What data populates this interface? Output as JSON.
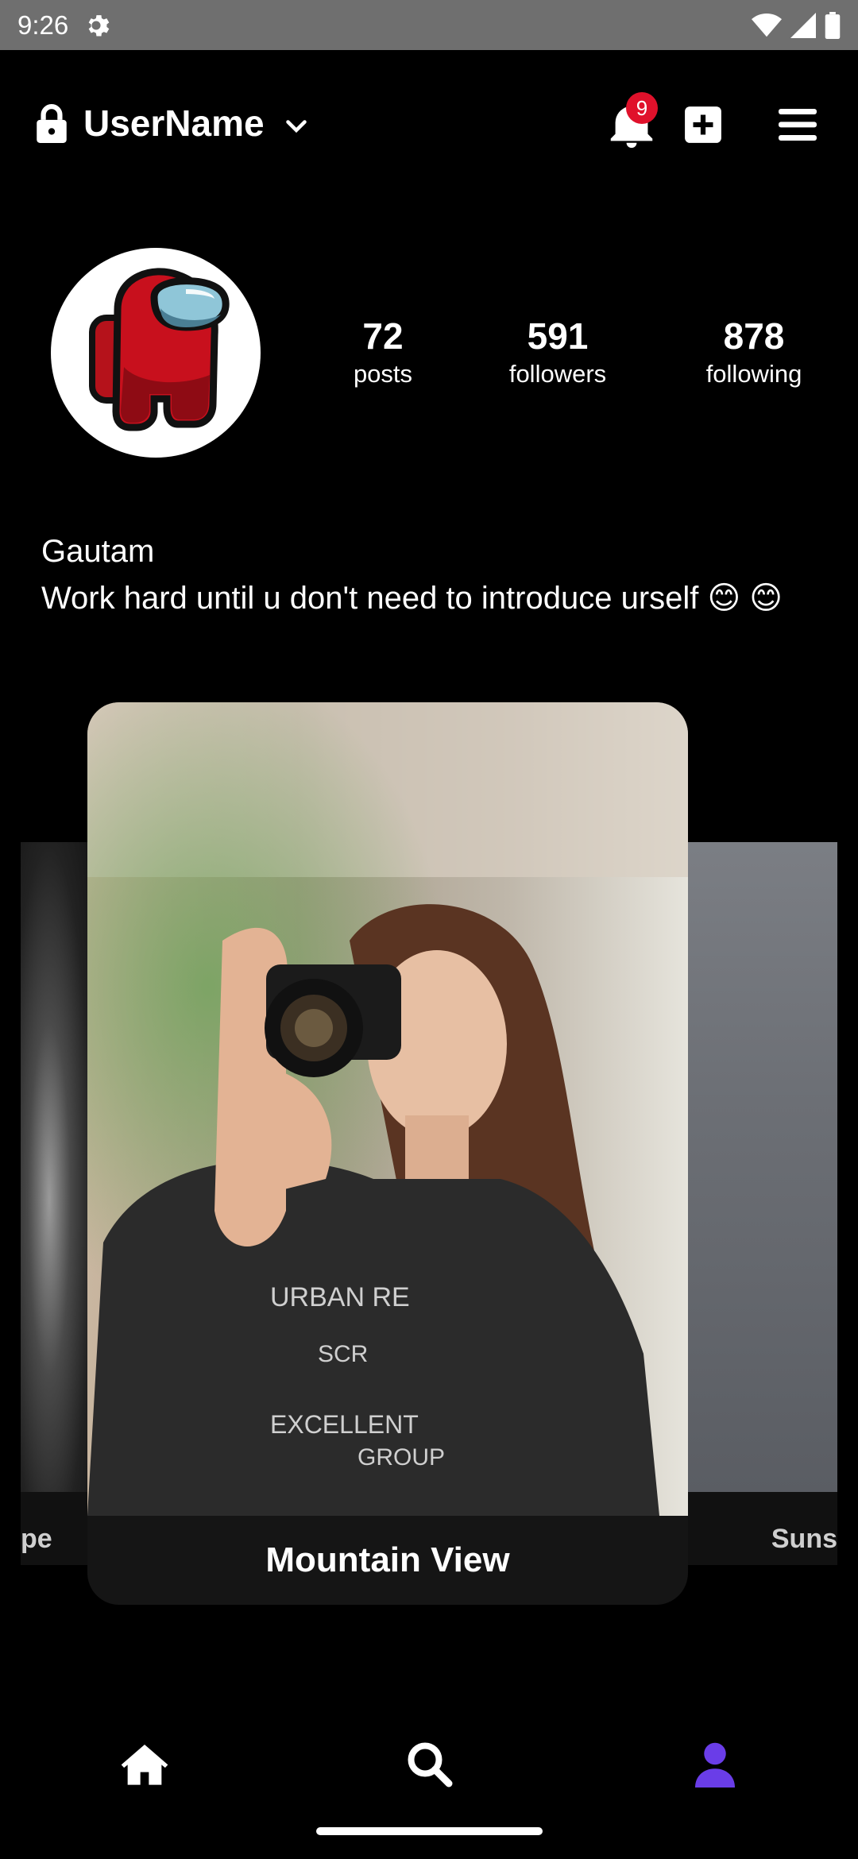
{
  "status_bar": {
    "time": "9:26",
    "icons": [
      "gear-icon",
      "wifi-icon",
      "signal-icon",
      "battery-icon"
    ]
  },
  "header": {
    "username": "UserName",
    "notification_count": "9",
    "icons": [
      "lock-icon",
      "chevron-down-icon",
      "bell-icon",
      "add-square-icon",
      "menu-icon"
    ]
  },
  "profile": {
    "stats": [
      {
        "value": "72",
        "label": "posts"
      },
      {
        "value": "591",
        "label": "followers"
      },
      {
        "value": "878",
        "label": "following"
      }
    ],
    "name": "Gautam",
    "bio": "Work hard until u don't need to introduce urself 😊 😊"
  },
  "carousel": {
    "left_caption": "pe",
    "center_caption": "Mountain View",
    "right_caption": "Suns"
  },
  "bottom_nav": {
    "items": [
      "home-icon",
      "search-icon",
      "profile-icon"
    ],
    "active": "profile-icon",
    "active_color": "#6a3de8"
  },
  "colors": {
    "background": "#000000",
    "status_bar": "#6f6f6f",
    "badge": "#e0112b",
    "accent": "#6a3de8"
  }
}
